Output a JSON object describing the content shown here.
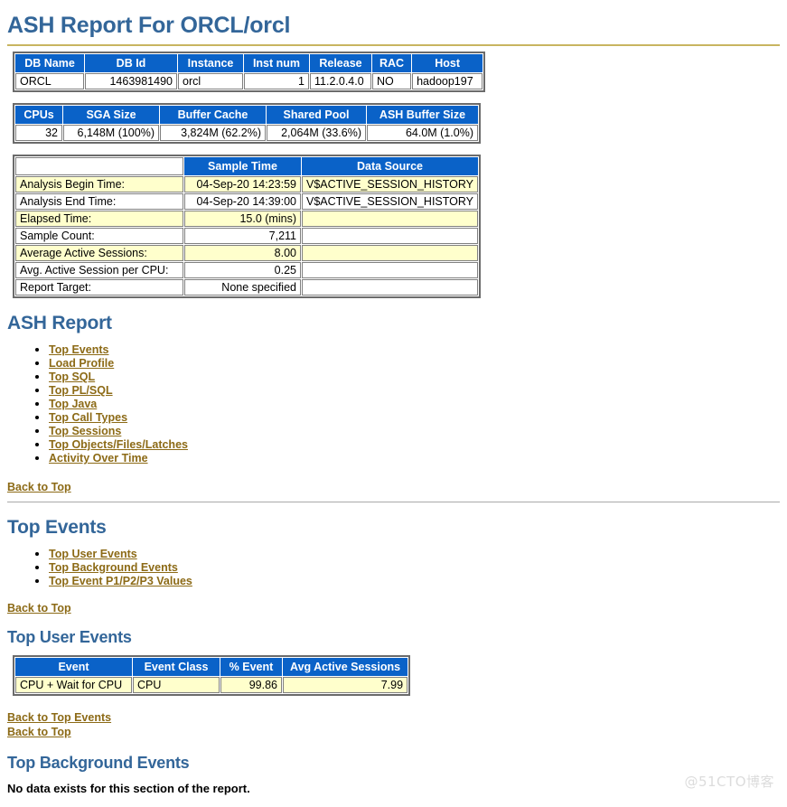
{
  "report": {
    "title": "ASH Report For ORCL/orcl"
  },
  "db_info_table": {
    "headers": [
      "DB Name",
      "DB Id",
      "Instance",
      "Inst num",
      "Release",
      "RAC",
      "Host"
    ],
    "rows": [
      {
        "db_name": "ORCL",
        "db_id": "1463981490",
        "instance": "orcl",
        "inst_num": "1",
        "release": "11.2.0.4.0",
        "rac": "NO",
        "host": "hadoop197"
      }
    ]
  },
  "memory_table": {
    "headers": [
      "CPUs",
      "SGA Size",
      "Buffer Cache",
      "Shared Pool",
      "ASH Buffer Size"
    ],
    "rows": [
      {
        "cpus": "32",
        "sga_size": "6,148M (100%)",
        "buffer_cache": "3,824M (62.2%)",
        "shared_pool": "2,064M (33.6%)",
        "ash_buffer_size": "64.0M (1.0%)"
      }
    ]
  },
  "analysis_table": {
    "headers": [
      "",
      "Sample Time",
      "Data Source"
    ],
    "rows": [
      {
        "label": "Analysis Begin Time:",
        "value": "04-Sep-20 14:23:59",
        "source": "V$ACTIVE_SESSION_HISTORY",
        "alt": true
      },
      {
        "label": "Analysis End Time:",
        "value": "04-Sep-20 14:39:00",
        "source": "V$ACTIVE_SESSION_HISTORY",
        "alt": false
      },
      {
        "label": "Elapsed Time:",
        "value": "15.0 (mins)",
        "source": "",
        "alt": true
      },
      {
        "label": "Sample Count:",
        "value": "7,211",
        "source": "",
        "alt": false
      },
      {
        "label": "Average Active Sessions:",
        "value": "8.00",
        "source": "",
        "alt": true
      },
      {
        "label": "Avg. Active Session per CPU:",
        "value": "0.25",
        "source": "",
        "alt": false
      },
      {
        "label": "Report Target:",
        "value": "None specified",
        "source": "",
        "alt": false
      }
    ]
  },
  "ash_report": {
    "heading": "ASH Report",
    "toc": [
      "Top Events",
      "Load Profile",
      "Top SQL",
      "Top PL/SQL",
      "Top Java",
      "Top Call Types",
      "Top Sessions",
      "Top Objects/Files/Latches",
      "Activity Over Time"
    ],
    "back_to_top": "Back to Top"
  },
  "top_events": {
    "heading": "Top Events",
    "toc": [
      "Top User Events",
      "Top Background Events",
      "Top Event P1/P2/P3 Values"
    ],
    "back_to_top": "Back to Top"
  },
  "top_user_events": {
    "heading": "Top User Events",
    "headers": [
      "Event",
      "Event Class",
      "% Event",
      "Avg Active Sessions"
    ],
    "rows": [
      {
        "event": "CPU + Wait for CPU",
        "event_class": "CPU",
        "pct_event": "99.86",
        "avg_active_sessions": "7.99"
      }
    ],
    "back_to_top_events": "Back to Top Events",
    "back_to_top": "Back to Top"
  },
  "top_background_events": {
    "heading": "Top Background Events",
    "no_data": "No data exists for this section of the report."
  },
  "watermark": {
    "text": "@51CTO博客"
  },
  "colors": {
    "heading_blue": "#336699",
    "table_header_blue": "#0a62c8",
    "alt_row_yellow": "#ffffcc",
    "link_brown": "#8c6a16",
    "title_rule": "#c8b560"
  }
}
